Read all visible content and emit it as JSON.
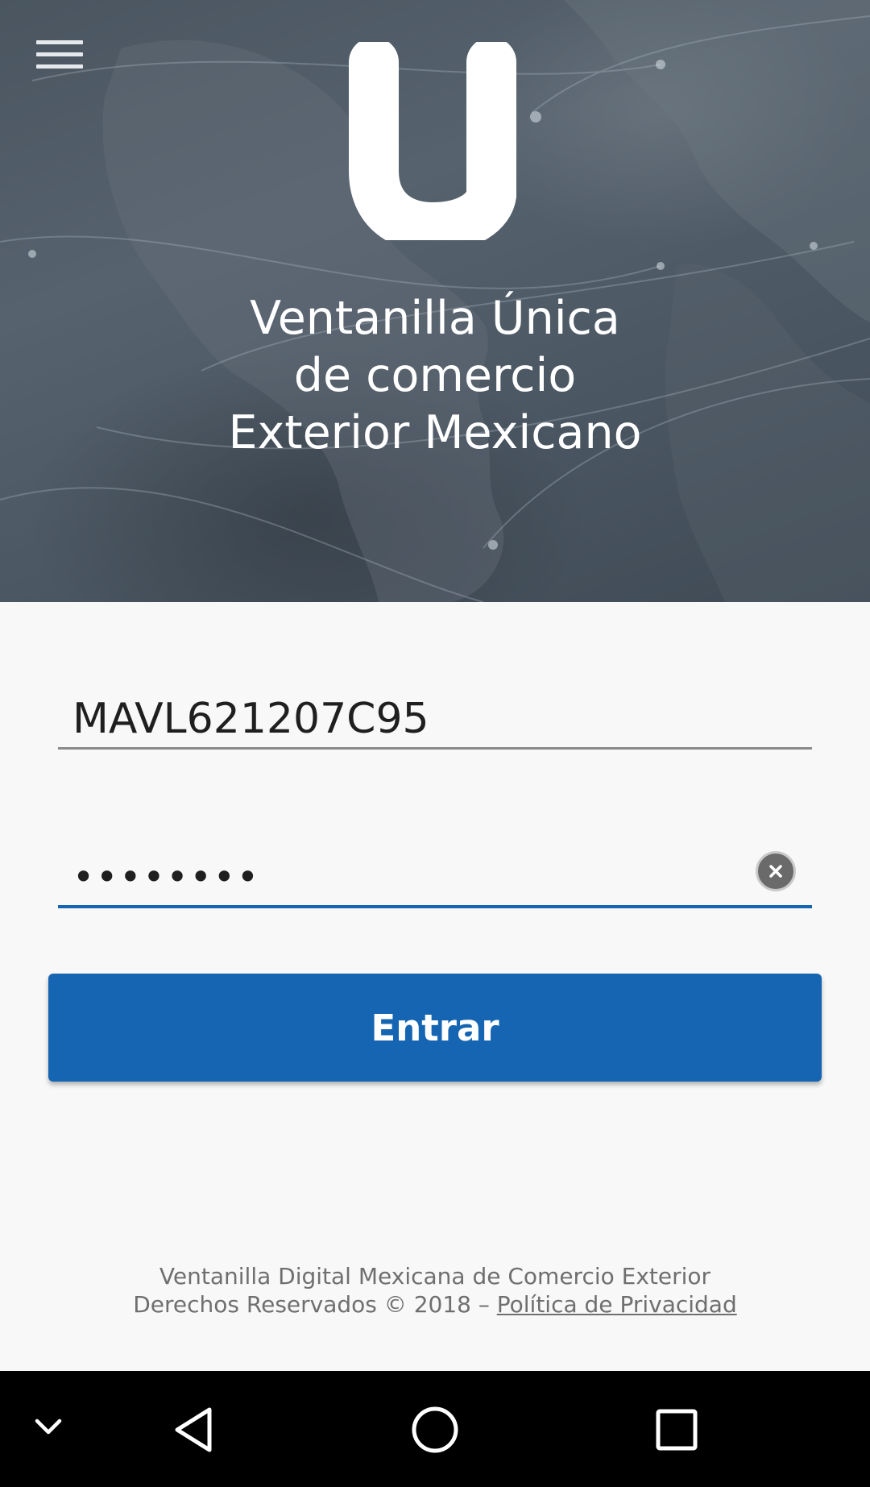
{
  "header": {
    "menu_icon": "hamburger-menu-icon",
    "logo_letter": "u",
    "title_lines": [
      "Ventanilla Única",
      "de comercio",
      "Exterior Mexicano"
    ]
  },
  "login": {
    "username_value": "MAVL621207C95",
    "password_value": "••••••••",
    "clear_icon": "clear-icon",
    "submit_label": "Entrar"
  },
  "footer": {
    "line1": "Ventanilla Digital Mexicana de Comercio Exterior",
    "line2_prefix": "Derechos Reservados © 2018 – ",
    "privacy_link": "Política de Privacidad"
  },
  "navbar": {
    "icons": [
      "chevron-down-icon",
      "back-icon",
      "home-icon",
      "recents-icon"
    ]
  },
  "colors": {
    "primary": "#1565b3",
    "hero_bg": "#4f5b66",
    "page_bg": "#f8f8f8",
    "navbar_bg": "#000000"
  }
}
